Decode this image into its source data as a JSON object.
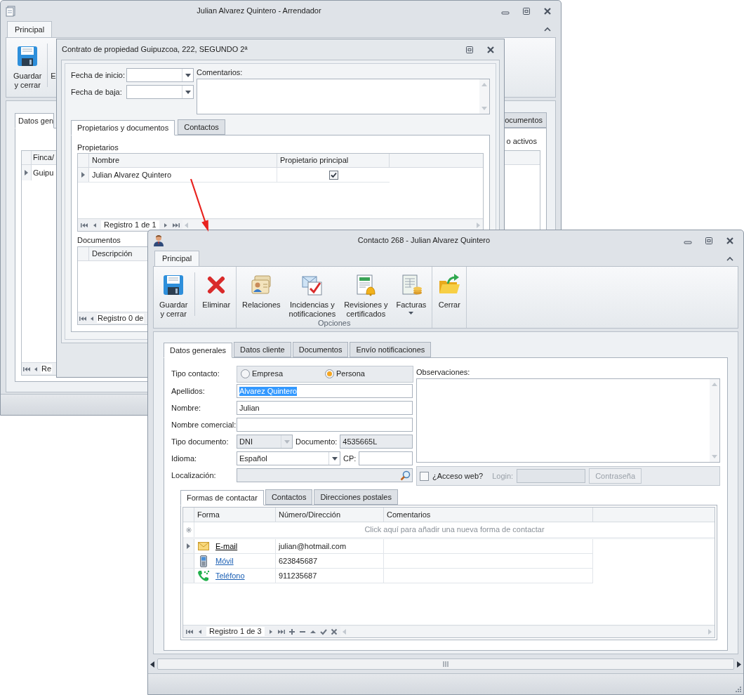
{
  "arrendador_window": {
    "title": "Julian Alvarez Quintero - Arrendador",
    "ribbon_tab": "Principal",
    "ribbon_buttons": [
      {
        "kind": "save",
        "label": "Guardar y cerrar"
      }
    ],
    "partial_button": "E",
    "tabs": [
      {
        "label": "Datos gen",
        "selected": true
      },
      {
        "label": "ocumentos",
        "selected": false
      }
    ],
    "filter_text": "o activos",
    "grid": {
      "columns": [
        "Finca/"
      ],
      "rows": [
        {
          "cells": [
            "Guipu"
          ],
          "current": true
        }
      ],
      "pager": "Re"
    }
  },
  "contrato_window": {
    "title": "Contrato de propiedad Guipuzcoa, 222, SEGUNDO 2ª",
    "date_fields": [
      {
        "label": "Fecha de inicio:"
      },
      {
        "label": "Fecha de baja:"
      }
    ],
    "comments_label": "Comentarios:",
    "tabs": [
      {
        "label": "Propietarios y documentos",
        "selected": true
      },
      {
        "label": "Contactos",
        "selected": false
      }
    ],
    "owners": {
      "title": "Propietarios",
      "columns": [
        "Nombre",
        "Propietario principal"
      ],
      "rows": [
        {
          "name": "Julian Alvarez Quintero",
          "principal": true,
          "current": true
        }
      ],
      "pager": "Registro 1 de 1"
    },
    "documents": {
      "title": "Documentos",
      "columns": [
        "Descripción"
      ],
      "pager": "Registro 0 de"
    }
  },
  "contacto_window": {
    "title": "Contacto 268 - Julian Alvarez Quintero",
    "ribbon_tab": "Principal",
    "ribbon_groups": [
      {
        "buttons": [
          {
            "kind": "save",
            "label": "Guardar y cerrar"
          },
          {
            "kind": "delete",
            "label": "Eliminar"
          }
        ]
      },
      {
        "label": "Opciones",
        "buttons": [
          {
            "kind": "relations",
            "label": "Relaciones"
          },
          {
            "kind": "incidents",
            "label": "Incidencias y notificaciones"
          },
          {
            "kind": "reviews",
            "label": "Revisiones y certificados"
          },
          {
            "kind": "invoices",
            "label": "Facturas",
            "dropdown": true
          }
        ]
      },
      {
        "buttons": [
          {
            "kind": "close",
            "label": "Cerrar"
          }
        ]
      }
    ],
    "tabs": [
      {
        "label": "Datos generales",
        "selected": true
      },
      {
        "label": "Datos cliente",
        "selected": false
      },
      {
        "label": "Documentos",
        "selected": false
      },
      {
        "label": "Envío notificaciones",
        "selected": false
      }
    ],
    "contact_type": {
      "label": "Tipo contacto:",
      "options": [
        {
          "label": "Empresa",
          "selected": false
        },
        {
          "label": "Persona",
          "selected": true
        }
      ]
    },
    "form_rows": [
      {
        "kind": "text",
        "label": "Apellidos:",
        "value": "Alvarez Quintero",
        "highlighted": true
      },
      {
        "kind": "text",
        "label": "Nombre:",
        "value": "Julian",
        "highlighted": false
      },
      {
        "kind": "text",
        "label": "Nombre comercial:",
        "highlighted": false
      },
      {
        "kind": "pair",
        "label": "Tipo documento:",
        "value": "DNI",
        "disabled": true,
        "second_label": "Documento:",
        "second_value": "4535665L",
        "second_disabled": true
      },
      {
        "kind": "pair",
        "label": "Idioma:",
        "value": "Español",
        "disabled": false,
        "second_label": "CP:",
        "second_disabled": false
      },
      {
        "kind": "search",
        "label": "Localización:",
        "disabled": true
      }
    ],
    "observations_label": "Observaciones:",
    "web_access": {
      "label": "¿Acceso web?",
      "checked": false,
      "login_label": "Login:",
      "password_button": "Contraseña",
      "disabled": true
    },
    "subtabs": [
      {
        "label": "Formas de contactar",
        "selected": true
      },
      {
        "label": "Contactos",
        "selected": false
      },
      {
        "label": "Direcciones postales",
        "selected": false
      }
    ],
    "contact_grid": {
      "columns": [
        "Forma",
        "Número/Dirección",
        "Comentarios"
      ],
      "new_row": "Click aquí para añadir una nueva forma de contactar",
      "rows": [
        {
          "kind": "email",
          "form": "E-mail",
          "value": "julian@hotmail.com",
          "current": true
        },
        {
          "kind": "mobile",
          "form": "Móvil",
          "value": "623845687",
          "current": false
        },
        {
          "kind": "phone",
          "form": "Teléfono",
          "value": "911235687",
          "current": false
        }
      ],
      "pager": "Registro 1 de 3"
    }
  }
}
